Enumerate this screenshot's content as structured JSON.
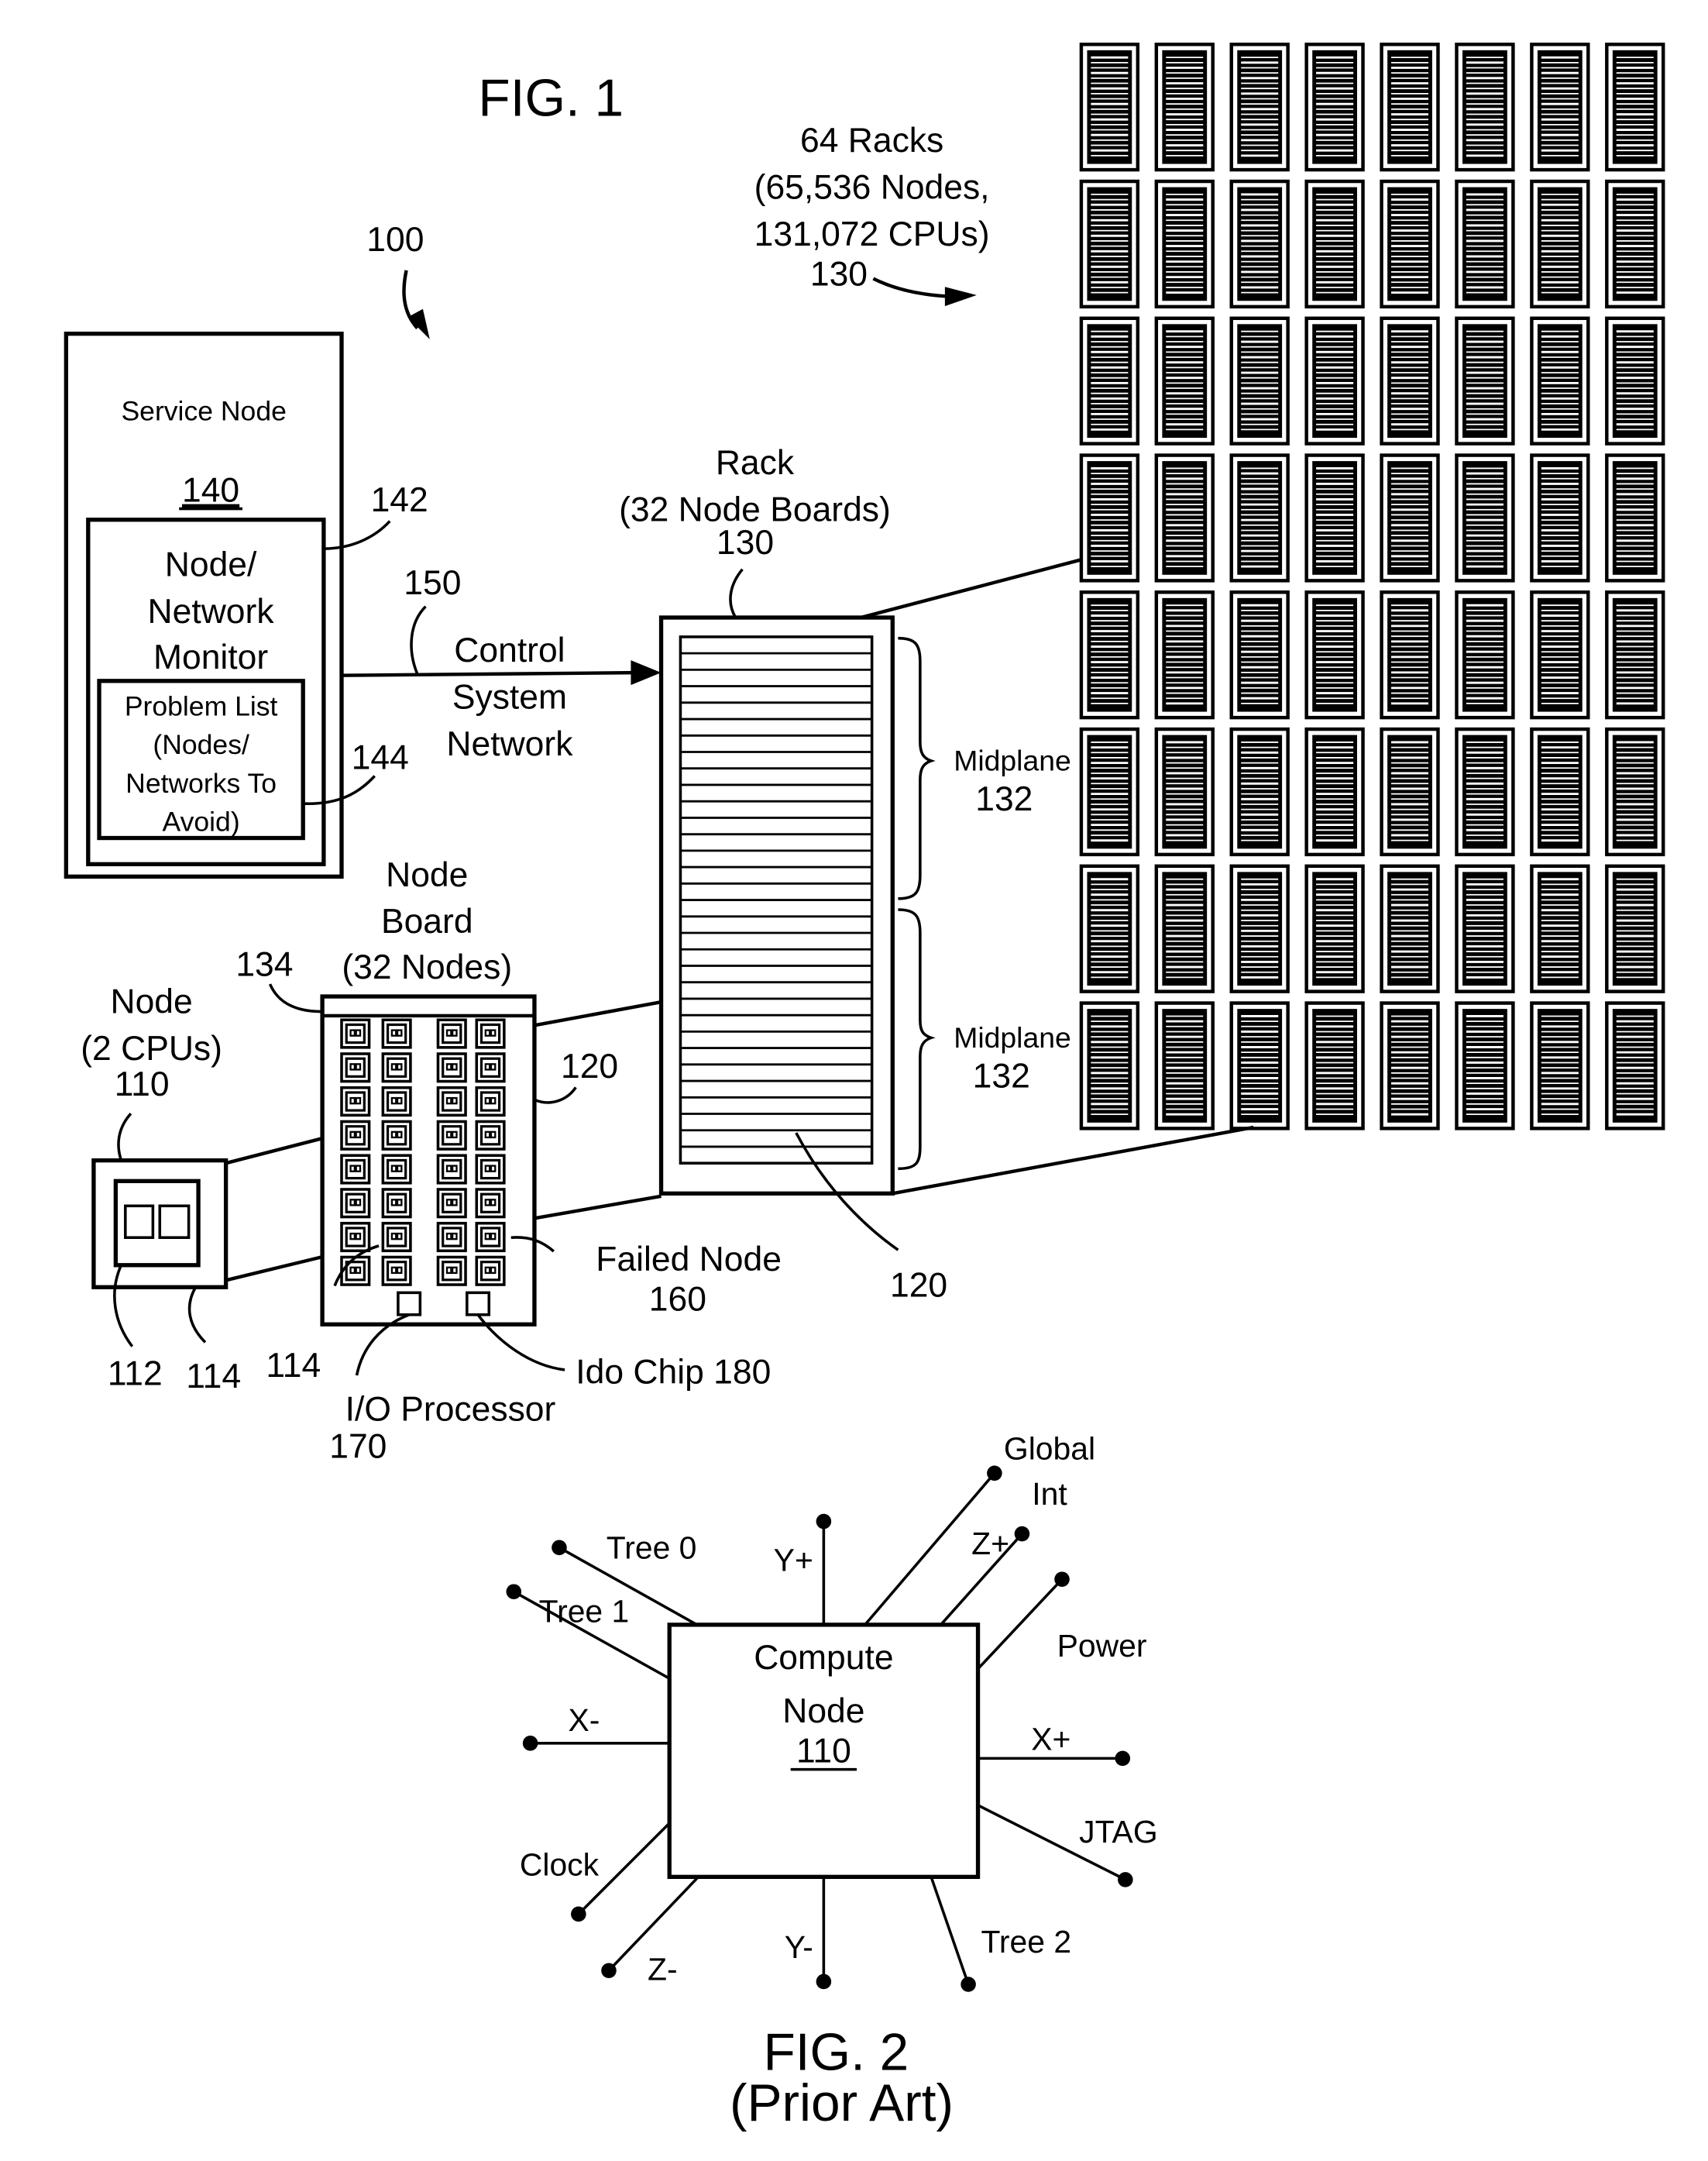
{
  "figure1": {
    "title": "FIG. 1",
    "system_ref": "100",
    "racks_group": {
      "line1": "64 Racks",
      "line2": "(65,536 Nodes,",
      "line3": "131,072 CPUs)",
      "ref": "130",
      "rows": 8,
      "columns": 8
    },
    "service_node": {
      "label": "Service Node",
      "ref": "140",
      "monitor": {
        "line1": "Node/",
        "line2": "Network",
        "line3": "Monitor",
        "ref": "142"
      },
      "problem_list": {
        "line1": "Problem List",
        "line2": "(Nodes/",
        "line3": "Networks To",
        "line4": "Avoid)",
        "ref": "144"
      }
    },
    "control_network": {
      "line1": "Control",
      "line2": "System",
      "line3": "Network",
      "ref": "150"
    },
    "rack": {
      "line1": "Rack",
      "line2": "(32 Node Boards)",
      "ref": "130",
      "board_ref": "120",
      "midplane_label": "Midplane",
      "midplane_ref": "132",
      "slots_per_midplane": 16
    },
    "node_board": {
      "line1": "Node",
      "line2": "Board",
      "line3": "(32 Nodes)",
      "ref": "134",
      "board_ref": "120",
      "node_columns": 4,
      "node_rows": 8,
      "failed_node_label": "Failed Node",
      "failed_node_ref": "160",
      "io_processor_label": "I/O Processor",
      "io_processor_ref": "170",
      "ido_chip_label": "Ido Chip 180",
      "chip_ref": "114"
    },
    "node": {
      "line1": "Node",
      "line2": "(2 CPUs)",
      "ref": "110",
      "cpu_ref": "112",
      "chip_ref": "114"
    }
  },
  "figure2": {
    "title": "FIG. 2",
    "subtitle": "(Prior Art)",
    "compute_node": {
      "line1": "Compute",
      "line2": "Node",
      "ref": "110"
    },
    "connections": {
      "tree0": "Tree 0",
      "tree1": "Tree 1",
      "tree2": "Tree 2",
      "y_plus": "Y+",
      "y_minus": "Y-",
      "x_plus": "X+",
      "x_minus": "X-",
      "z_plus": "Z+",
      "z_minus": "Z-",
      "global_int_1": "Global",
      "global_int_2": "Int",
      "power": "Power",
      "jtag": "JTAG",
      "clock": "Clock"
    }
  }
}
